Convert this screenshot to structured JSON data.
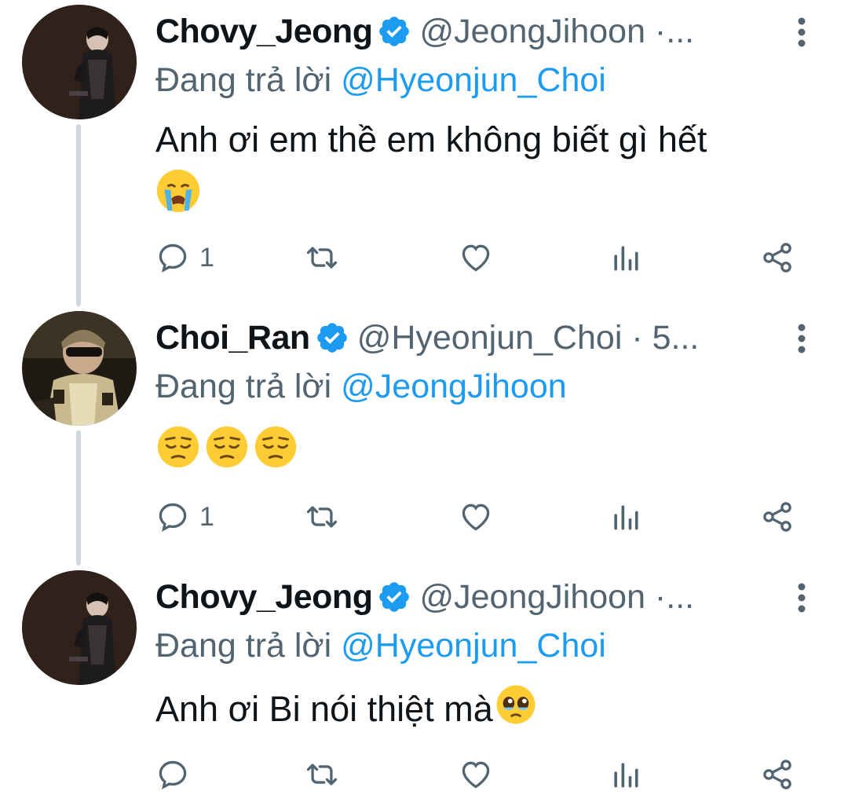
{
  "colors": {
    "accent": "#1d9bf0",
    "secondary_text": "#536471",
    "primary_text": "#0f1419",
    "thread_line": "#cfd9de"
  },
  "tweets": [
    {
      "display_name": "Chovy_Jeong",
      "handle": "@JeongJihoon ·...",
      "verified": true,
      "reply_prefix": "Đang trả lời",
      "reply_to": "@Hyeonjun_Choi",
      "text_line1": "Anh ơi em thề em không biết gì hết",
      "emojis": [
        "loudly-crying-face"
      ],
      "reply_count": "1",
      "avatar": "avatar-chovy"
    },
    {
      "display_name": "Choi_Ran",
      "handle": "@Hyeonjun_Choi · 5...",
      "verified": true,
      "reply_prefix": "Đang trả lời",
      "reply_to": "@JeongJihoon",
      "text_line1": "",
      "emojis": [
        "pensive-face",
        "pensive-face",
        "pensive-face"
      ],
      "reply_count": "1",
      "avatar": "avatar-choi"
    },
    {
      "display_name": "Chovy_Jeong",
      "handle": "@JeongJihoon ·...",
      "verified": true,
      "reply_prefix": "Đang trả lời",
      "reply_to": "@Hyeonjun_Choi",
      "text_line1": "Anh ơi Bi nói thiệt mà",
      "emojis": [
        "pleading-face"
      ],
      "reply_count": "",
      "avatar": "avatar-chovy"
    }
  ],
  "icons": {
    "reply": "reply-icon",
    "retweet": "retweet-icon",
    "like": "heart-icon",
    "views": "views-icon",
    "share": "share-icon",
    "more": "more-vertical-icon",
    "verified": "verified-badge-icon"
  }
}
